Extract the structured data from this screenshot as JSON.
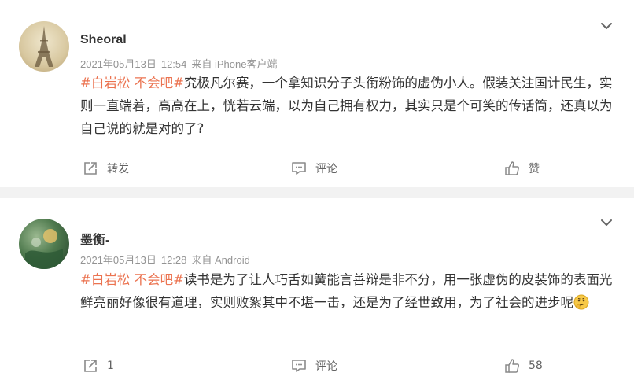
{
  "comments": [
    {
      "username": "Sheoral",
      "date": "2021年05月13日",
      "time": "12:54",
      "source": "来自 iPhone客户端",
      "topic": "#白岩松 不会吧#",
      "text": "究极凡尔赛，一个拿知识分子头衔粉饰的虚伪小人。假装关注国计民生，实则一直端着，高高在上，恍若云端，以为自己拥有权力，其实只是个可笑的传话筒，还真以为自己说的就是对的了?",
      "repost_label": "转发",
      "comment_label": "评论",
      "like_label": "赞"
    },
    {
      "username": "墨衡-",
      "date": "2021年05月13日",
      "time": "12:28",
      "source": "来自 Android",
      "topic": "#白岩松 不会吧#",
      "text": "读书是为了让人巧舌如簧能言善辩是非不分，用一张虚伪的皮装饰的表面光鲜亮丽好像很有道理，实则败絮其中不堪一击，还是为了经世致用，为了社会的进步呢",
      "emoji": "thinking-face-emoji",
      "repost_label": "1",
      "comment_label": "评论",
      "like_label": "58"
    }
  ],
  "colors": {
    "topic": "#eb7350",
    "meta": "#939393",
    "background": "#f2f2f2"
  },
  "icons": [
    "chevron-down-icon",
    "repost-icon",
    "comment-icon",
    "like-icon"
  ]
}
